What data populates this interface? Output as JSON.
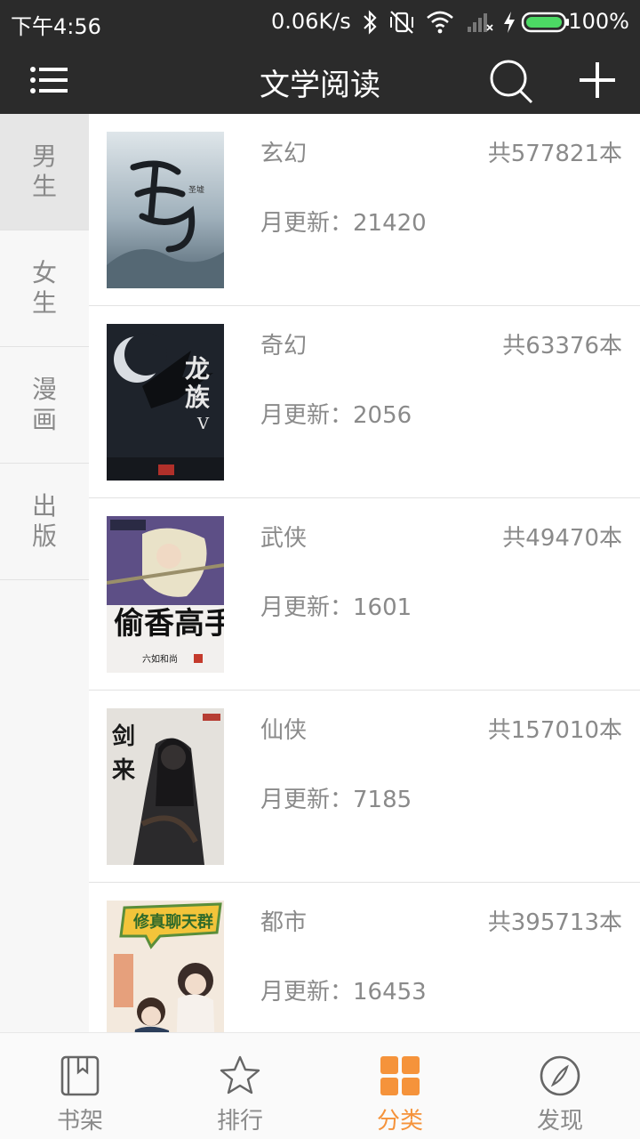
{
  "status_bar": {
    "time": "下午4:56",
    "speed": "0.06K/s",
    "battery": "100%"
  },
  "app_bar": {
    "title": "文学阅读"
  },
  "sidebar": {
    "items": [
      {
        "label": "男生",
        "active": true
      },
      {
        "label": "女生",
        "active": false
      },
      {
        "label": "漫画",
        "active": false
      },
      {
        "label": "出版",
        "active": false
      }
    ]
  },
  "categories": [
    {
      "name": "玄幻",
      "total": "共577821本",
      "update": "月更新：21420",
      "cover_title": "圣墟"
    },
    {
      "name": "奇幻",
      "total": "共63376本",
      "update": "月更新：2056",
      "cover_title": "龙族V"
    },
    {
      "name": "武侠",
      "total": "共49470本",
      "update": "月更新：1601",
      "cover_title": "偷香高手"
    },
    {
      "name": "仙侠",
      "total": "共157010本",
      "update": "月更新：7185",
      "cover_title": "剑来"
    },
    {
      "name": "都市",
      "total": "共395713本",
      "update": "月更新：16453",
      "cover_title": "修真聊天群"
    }
  ],
  "bottom_nav": {
    "items": [
      {
        "label": "书架",
        "icon": "bookshelf-icon",
        "active": false
      },
      {
        "label": "排行",
        "icon": "star-icon",
        "active": false
      },
      {
        "label": "分类",
        "icon": "category-grid-icon",
        "active": true
      },
      {
        "label": "发现",
        "icon": "compass-icon",
        "active": false
      }
    ]
  },
  "colors": {
    "bar": "#2b2b2b",
    "accent": "#f5933b",
    "text_gray": "#8a8a8a"
  }
}
